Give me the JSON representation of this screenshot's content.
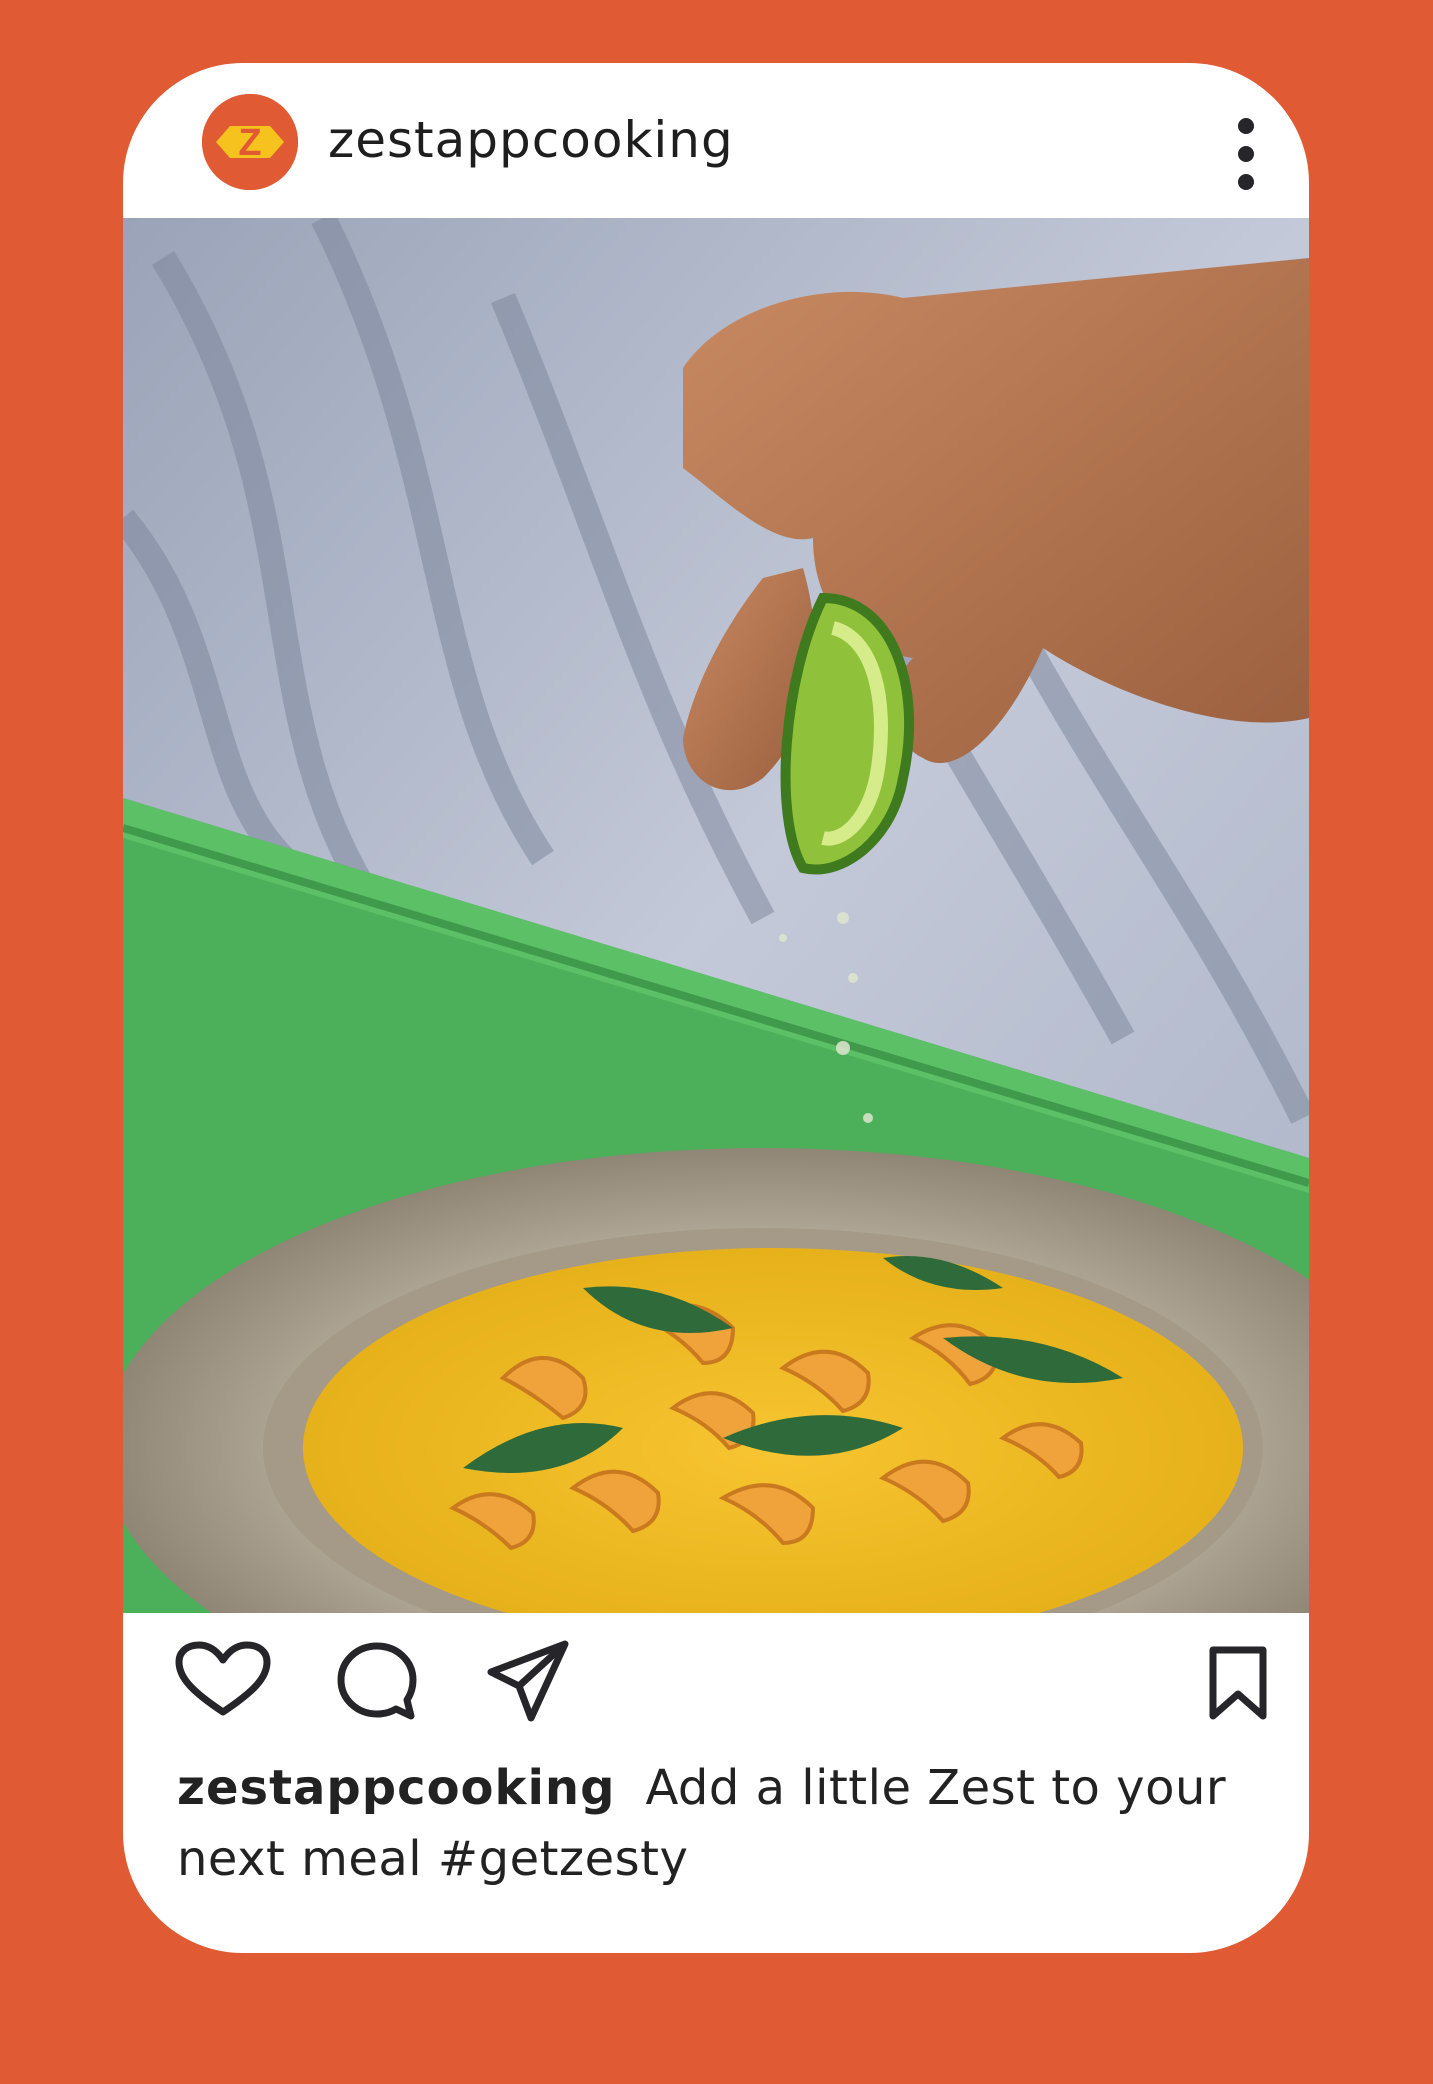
{
  "post": {
    "username": "zestappcooking",
    "avatar_letter": "Z",
    "caption_username": "zestappcooking",
    "caption_text": "Add a little Zest to your next meal #getzesty"
  },
  "icons": {
    "avatar": "zest-logo-icon",
    "more": "more-vertical-icon",
    "like": "heart-icon",
    "comment": "comment-bubble-icon",
    "share": "paper-plane-icon",
    "save": "bookmark-icon"
  },
  "colors": {
    "background": "#e05a33",
    "card": "#ffffff",
    "brand_yellow": "#f6c21d",
    "text": "#222222",
    "icon": "#26262a"
  }
}
